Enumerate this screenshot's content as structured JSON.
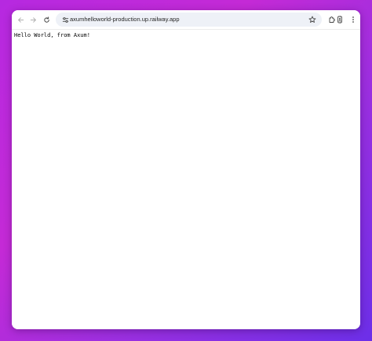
{
  "browser": {
    "url": "axumhelloworld-production.up.railway.app",
    "icons": {
      "back": "arrow-left-icon",
      "forward": "arrow-right-icon",
      "reload": "reload-icon",
      "site_info": "tune-icon",
      "bookmark": "star-icon",
      "extensions": "puzzle-icon",
      "profile": "profile-icon",
      "menu": "kebab-menu-icon"
    }
  },
  "page": {
    "body_text": "Hello World, from Axum!"
  },
  "colors": {
    "background_gradient": [
      "#b629e0",
      "#6c2fe8"
    ],
    "omnibox": "#eef1f7",
    "window": "#ffffff"
  }
}
